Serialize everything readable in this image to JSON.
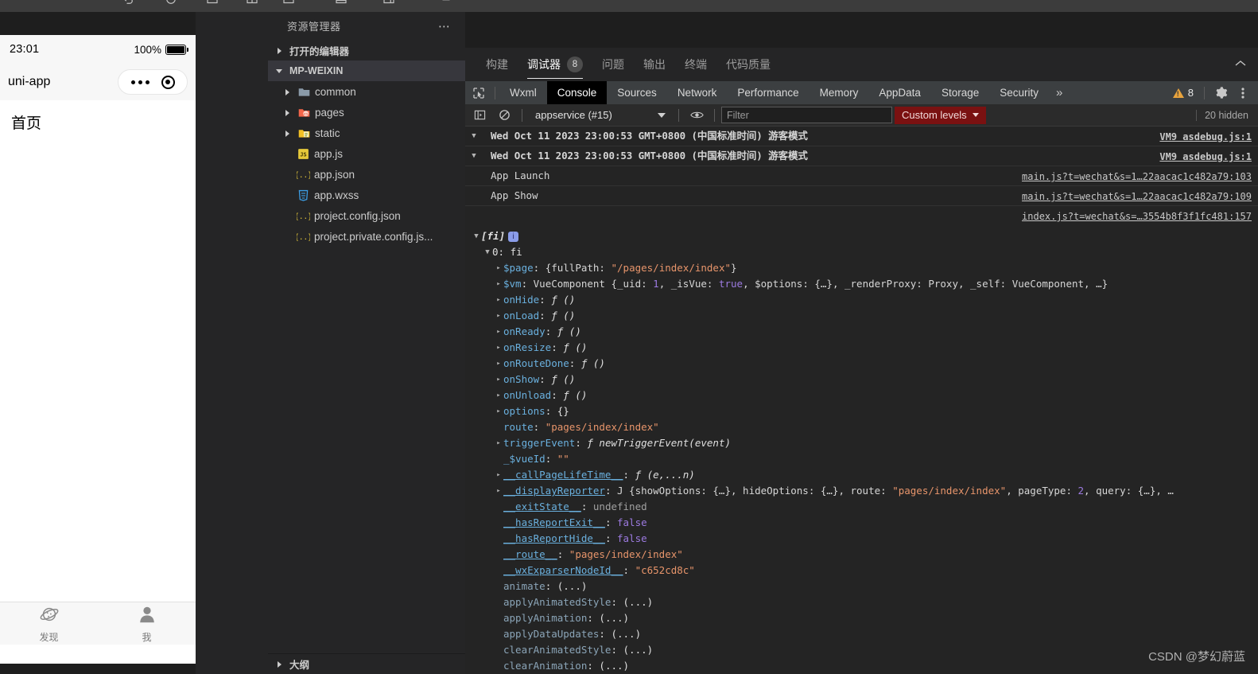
{
  "simulator": {
    "status": {
      "time": "23:01",
      "battery_pct": "100%",
      "battery_icon": "battery-full-icon"
    },
    "navbar": {
      "title": "uni-app",
      "capsule_menu_icon": "more-dots-icon",
      "capsule_target_icon": "target-icon"
    },
    "page": {
      "heading": "首页"
    },
    "tabbar": [
      {
        "label": "发现",
        "icon": "planet-icon"
      },
      {
        "label": "我",
        "icon": "person-icon"
      }
    ]
  },
  "explorer": {
    "title": "资源管理器",
    "more_icon": "ellipsis-icon",
    "sections": [
      {
        "label": "打开的编辑器",
        "expanded": false
      },
      {
        "label": "MP-WEIXIN",
        "expanded": true,
        "selected": true
      }
    ],
    "files": [
      {
        "label": "common",
        "icon": "folder-icon",
        "kind": "folder",
        "expanded": false
      },
      {
        "label": "pages",
        "icon": "folder-pages-icon",
        "kind": "folder",
        "expanded": false
      },
      {
        "label": "static",
        "icon": "folder-static-icon",
        "kind": "folder",
        "expanded": false
      },
      {
        "label": "app.js",
        "icon": "js-file-icon",
        "kind": "file"
      },
      {
        "label": "app.json",
        "icon": "json-file-icon",
        "kind": "file"
      },
      {
        "label": "app.wxss",
        "icon": "css-file-icon",
        "kind": "file"
      },
      {
        "label": "project.config.json",
        "icon": "json-file-icon",
        "kind": "file"
      },
      {
        "label": "project.private.config.js...",
        "icon": "json-file-icon",
        "kind": "file"
      }
    ],
    "outline": {
      "label": "大纲",
      "expanded": false
    }
  },
  "panel": {
    "tabs": [
      {
        "label": "构建",
        "active": false,
        "badge": ""
      },
      {
        "label": "调试器",
        "active": true,
        "badge": "8"
      },
      {
        "label": "问题",
        "active": false,
        "badge": ""
      },
      {
        "label": "输出",
        "active": false,
        "badge": ""
      },
      {
        "label": "终端",
        "active": false,
        "badge": ""
      },
      {
        "label": "代码质量",
        "active": false,
        "badge": ""
      }
    ],
    "collapse_icon": "chevron-up-icon"
  },
  "devtools": {
    "inspect_icon": "inspect-cursor-icon",
    "tabs": [
      {
        "label": "Wxml",
        "active": false
      },
      {
        "label": "Console",
        "active": true
      },
      {
        "label": "Sources",
        "active": false
      },
      {
        "label": "Network",
        "active": false
      },
      {
        "label": "Performance",
        "active": false
      },
      {
        "label": "Memory",
        "active": false
      },
      {
        "label": "AppData",
        "active": false
      },
      {
        "label": "Storage",
        "active": false
      },
      {
        "label": "Security",
        "active": false
      }
    ],
    "more_tabs_icon": "double-chevron-right-icon",
    "warning_count": "8",
    "warning_icon": "warning-triangle-icon",
    "settings_icon": "gear-icon",
    "kebab_icon": "vertical-dots-icon"
  },
  "console_toolbar": {
    "sidebar_icon": "console-sidebar-icon",
    "clear_icon": "clear-console-icon",
    "context": "appservice (#15)",
    "context_caret": "chevron-down-icon",
    "eye_icon": "eye-icon",
    "filter_placeholder": "Filter",
    "filter_value": "",
    "levels_label": "Custom levels",
    "levels_caret": "chevron-down-icon",
    "hidden_note": "20 hidden"
  },
  "console_log": {
    "entries": [
      {
        "arrow": "▼",
        "text": "Wed Oct 11 2023 23:00:53 GMT+0800 (中国标准时间) 游客模式",
        "source": "VM9 asdebug.js:1",
        "bold": true
      },
      {
        "arrow": "▼",
        "text": "Wed Oct 11 2023 23:00:53 GMT+0800 (中国标准时间) 游客模式",
        "source": "VM9 asdebug.js:1",
        "bold": true
      },
      {
        "arrow": "",
        "text": "App Launch",
        "source": "main.js?t=wechat&s=1…22aacac1c482a79:103",
        "bold": false
      },
      {
        "arrow": "",
        "text": "App Show",
        "source": "main.js?t=wechat&s=1…22aacac1c482a79:109",
        "bold": false
      },
      {
        "arrow": "",
        "text": "",
        "source": "index.js?t=wechat&s=…3554b8f3f1fc481:157",
        "bold": false
      }
    ]
  },
  "object_tree": {
    "root_label": "[fi]",
    "root_badge": "i",
    "child_label": "0: fi",
    "rows": [
      {
        "indent": 2,
        "arrow": true,
        "key": "$page",
        "sep": ": ",
        "value": "{fullPath: \"/pages/index/index\"}",
        "vtype": "objpath"
      },
      {
        "indent": 2,
        "arrow": true,
        "key": "$vm",
        "sep": ": ",
        "value": "VueComponent {_uid: 1, _isVue: true, $options: {…}, _renderProxy: Proxy, _self: VueComponent, …}",
        "vtype": "vuecomp"
      },
      {
        "indent": 2,
        "arrow": true,
        "key": "onHide",
        "sep": ": ",
        "value": "ƒ ()",
        "vtype": "fn"
      },
      {
        "indent": 2,
        "arrow": true,
        "key": "onLoad",
        "sep": ": ",
        "value": "ƒ ()",
        "vtype": "fn"
      },
      {
        "indent": 2,
        "arrow": true,
        "key": "onReady",
        "sep": ": ",
        "value": "ƒ ()",
        "vtype": "fn"
      },
      {
        "indent": 2,
        "arrow": true,
        "key": "onResize",
        "sep": ": ",
        "value": "ƒ ()",
        "vtype": "fn"
      },
      {
        "indent": 2,
        "arrow": true,
        "key": "onRouteDone",
        "sep": ": ",
        "value": "ƒ ()",
        "vtype": "fn"
      },
      {
        "indent": 2,
        "arrow": true,
        "key": "onShow",
        "sep": ": ",
        "value": "ƒ ()",
        "vtype": "fn"
      },
      {
        "indent": 2,
        "arrow": true,
        "key": "onUnload",
        "sep": ": ",
        "value": "ƒ ()",
        "vtype": "fn"
      },
      {
        "indent": 2,
        "arrow": true,
        "key": "options",
        "sep": ": ",
        "value": "{}",
        "vtype": "plain"
      },
      {
        "indent": 2,
        "arrow": false,
        "key": "route",
        "sep": ": ",
        "value": "\"pages/index/index\"",
        "vtype": "str"
      },
      {
        "indent": 2,
        "arrow": true,
        "key": "triggerEvent",
        "sep": ": ",
        "value": "ƒ newTriggerEvent(event)",
        "vtype": "fn"
      },
      {
        "indent": 2,
        "arrow": false,
        "key": "_$vueId",
        "sep": ": ",
        "value": "\"\"",
        "vtype": "str"
      },
      {
        "indent": 2,
        "arrow": true,
        "key": "__callPageLifeTime__",
        "sep": ": ",
        "value": "ƒ (e,...n)",
        "vtype": "fn",
        "underline": true
      },
      {
        "indent": 2,
        "arrow": true,
        "key": "__displayReporter",
        "sep": ": ",
        "value": "J {showOptions: {…}, hideOptions: {…}, route: \"pages/index/index\", pageType: 2, query: {…}, …",
        "vtype": "reporter",
        "underline": true
      },
      {
        "indent": 2,
        "arrow": false,
        "key": "__exitState__",
        "sep": ": ",
        "value": "undefined",
        "vtype": "undef",
        "underline": true
      },
      {
        "indent": 2,
        "arrow": false,
        "key": "__hasReportExit__",
        "sep": ": ",
        "value": "false",
        "vtype": "bool",
        "underline": true
      },
      {
        "indent": 2,
        "arrow": false,
        "key": "__hasReportHide__",
        "sep": ": ",
        "value": "false",
        "vtype": "bool",
        "underline": true
      },
      {
        "indent": 2,
        "arrow": false,
        "key": "__route__",
        "sep": ": ",
        "value": "\"pages/index/index\"",
        "vtype": "str",
        "underline": true
      },
      {
        "indent": 2,
        "arrow": false,
        "key": "__wxExparserNodeId__",
        "sep": ": ",
        "value": "\"c652cd8c\"",
        "vtype": "str",
        "underline": true
      },
      {
        "indent": 2,
        "arrow": false,
        "key": "animate",
        "sep": ": ",
        "value": "(...)",
        "vtype": "getter",
        "dim": true
      },
      {
        "indent": 2,
        "arrow": false,
        "key": "applyAnimatedStyle",
        "sep": ": ",
        "value": "(...)",
        "vtype": "getter",
        "dim": true
      },
      {
        "indent": 2,
        "arrow": false,
        "key": "applyAnimation",
        "sep": ": ",
        "value": "(...)",
        "vtype": "getter",
        "dim": true
      },
      {
        "indent": 2,
        "arrow": false,
        "key": "applyDataUpdates",
        "sep": ": ",
        "value": "(...)",
        "vtype": "getter",
        "dim": true
      },
      {
        "indent": 2,
        "arrow": false,
        "key": "clearAnimatedStyle",
        "sep": ": ",
        "value": "(...)",
        "vtype": "getter",
        "dim": true
      },
      {
        "indent": 2,
        "arrow": false,
        "key": "clearAnimation",
        "sep": ": ",
        "value": "(...)",
        "vtype": "getter",
        "dim": true
      }
    ]
  },
  "watermark": {
    "text": "CSDN @梦幻蔚蓝"
  },
  "colors": {
    "editor_bg": "#1e1e1e",
    "sidebar_bg": "#252526",
    "console_bg": "#242424",
    "accent_active_tab": "#000000",
    "levels_chip_bg": "#7a1111",
    "string_color": "#e8956b",
    "prop_color": "#6ab0de",
    "number_color": "#9c7ae0"
  }
}
